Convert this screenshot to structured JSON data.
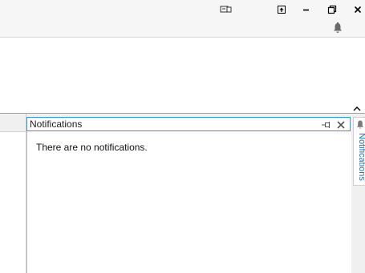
{
  "titlebar": {
    "buttons": [
      {
        "name": "display-icon"
      },
      {
        "name": "restore-to-top-icon"
      },
      {
        "name": "minimize-icon"
      },
      {
        "name": "restore-down-icon"
      },
      {
        "name": "close-icon"
      }
    ]
  },
  "notifications": {
    "panel_title": "Notifications",
    "empty_message": "There are no notifications.",
    "side_tab_label": "Notifications",
    "pin_icon": "pin-icon",
    "close_icon": "close-icon"
  },
  "colors": {
    "accent": "#3399cc",
    "side_label": "#1e73b4"
  }
}
